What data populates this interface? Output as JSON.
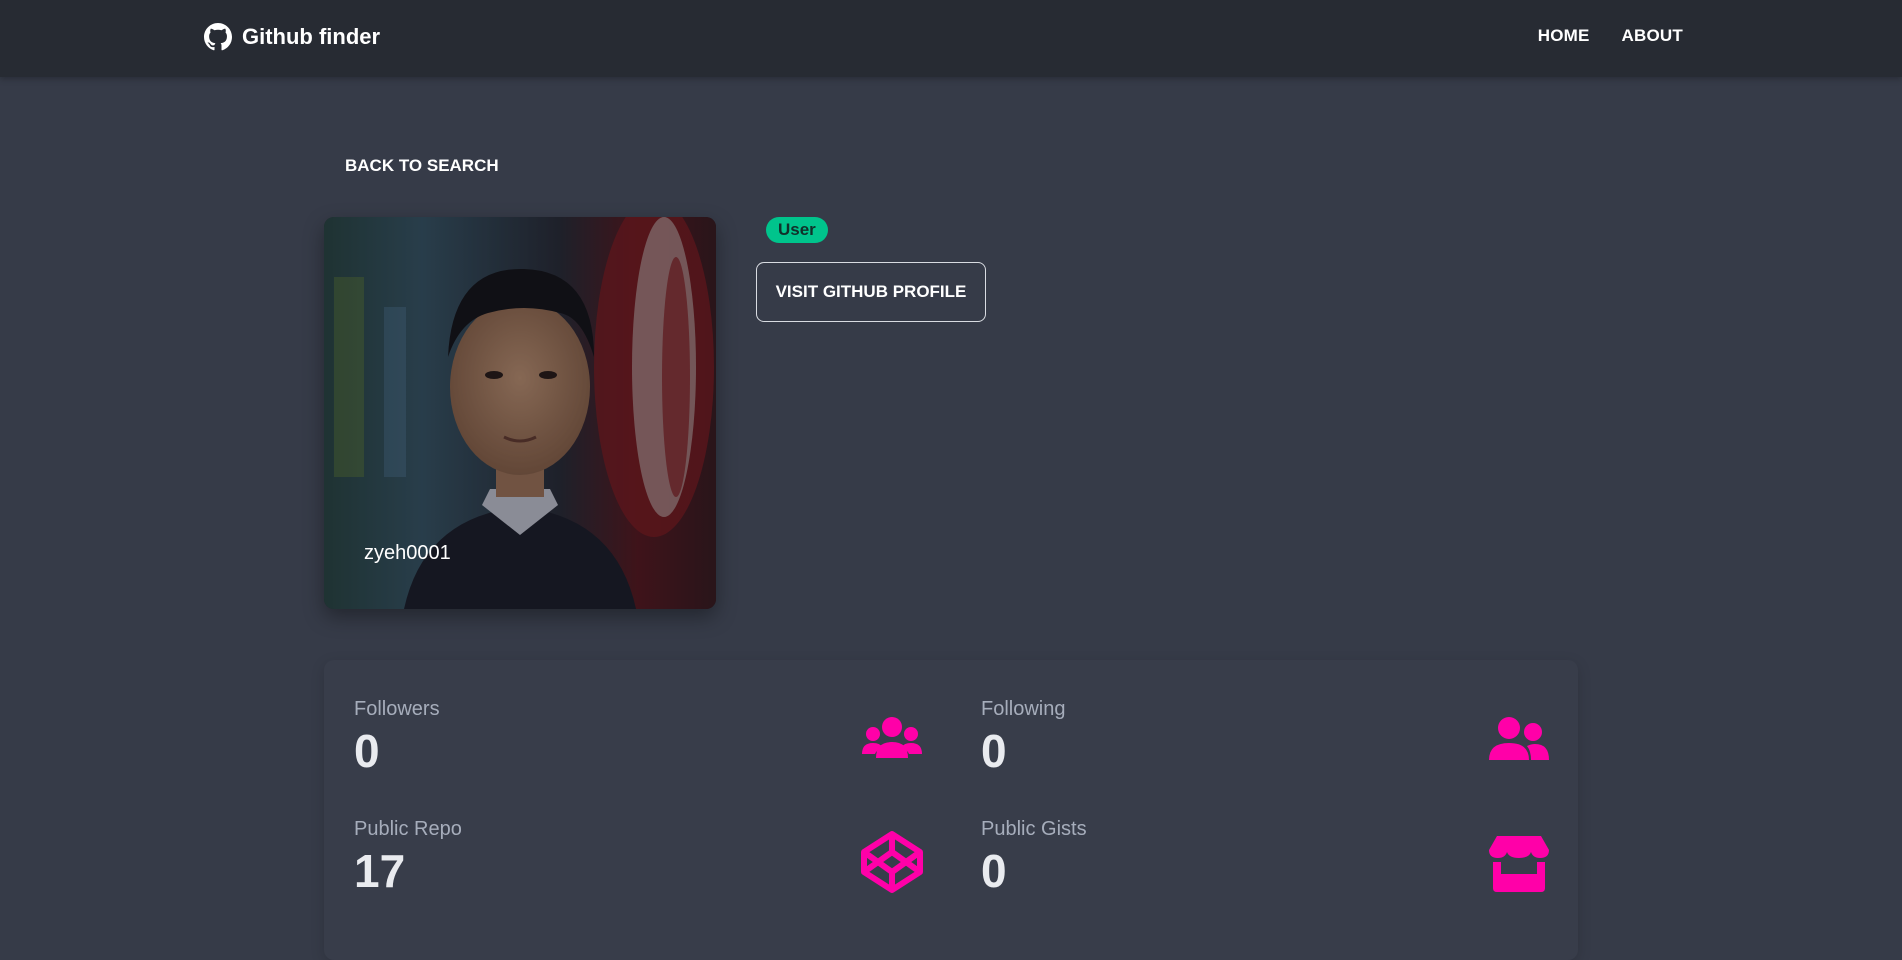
{
  "navbar": {
    "brand": "Github finder",
    "links": [
      "HOME",
      "ABOUT"
    ]
  },
  "actions": {
    "back": "BACK TO SEARCH",
    "visit": "VISIT GITHUB PROFILE"
  },
  "profile": {
    "login": "zyeh0001",
    "type_badge": "User"
  },
  "stats": [
    {
      "label": "Followers",
      "value": "0",
      "icon": "users-icon"
    },
    {
      "label": "Following",
      "value": "0",
      "icon": "user-friends-icon"
    },
    {
      "label": "Public Repo",
      "value": "17",
      "icon": "codepen-icon"
    },
    {
      "label": "Public Gists",
      "value": "0",
      "icon": "store-icon"
    }
  ],
  "colors": {
    "navbar_bg": "#272b33",
    "page_bg": "#363b48",
    "accent": "#ff00a8",
    "badge": "#00c48c"
  }
}
